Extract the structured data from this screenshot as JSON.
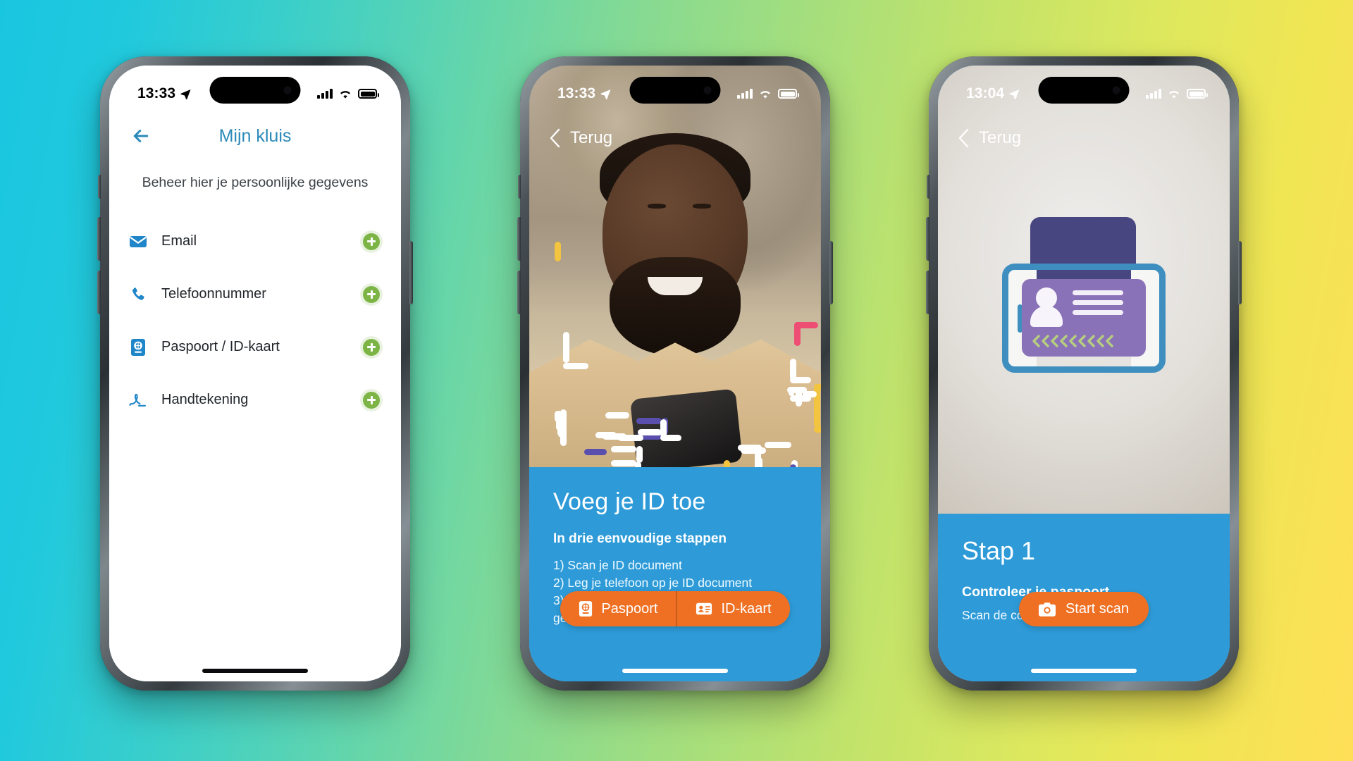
{
  "background": {
    "from": "#19c6e0",
    "mid": "#a3de7e",
    "to": "#ffdf57"
  },
  "theme": {
    "brand_blue": "#2b89b8",
    "panel_blue": "#2e9bd8",
    "orange": "#ef7023",
    "green": "#7cb446",
    "icon_blue": "#1f86c9",
    "purple_doc": "#474681",
    "purple_card": "#8a72b8",
    "chevron_green": "#b6cf7e"
  },
  "phones": [
    {
      "id": "phone-1",
      "status_bar": {
        "time": "13:33",
        "location_icon": "location-arrow-icon",
        "signal_icon": "cellular-bars-icon",
        "wifi_icon": "wifi-icon",
        "battery_icon": "battery-icon"
      },
      "screen": {
        "name": "mijn-kluis",
        "back_icon": "arrow-left-icon",
        "title": "Mijn kluis",
        "subtitle": "Beheer hier je persoonlijke gegevens",
        "rows": [
          {
            "icon": "envelope-icon",
            "label": "Email",
            "action_icon": "plus-circle-icon"
          },
          {
            "icon": "phone-icon",
            "label": "Telefoonnummer",
            "action_icon": "plus-circle-icon"
          },
          {
            "icon": "passport-icon",
            "label": "Paspoort / ID-kaart",
            "action_icon": "plus-circle-icon"
          },
          {
            "icon": "signature-icon",
            "label": "Handtekening",
            "action_icon": "plus-circle-icon"
          }
        ]
      }
    },
    {
      "id": "phone-2",
      "status_bar": {
        "time": "13:33",
        "location_icon": "location-arrow-icon",
        "signal_icon": "cellular-bars-icon",
        "wifi_icon": "wifi-icon",
        "battery_icon": "battery-icon"
      },
      "screen": {
        "name": "voeg-je-id-toe",
        "back_icon": "chevron-left-icon",
        "back_label": "Terug",
        "hero_alt": "man-with-phone-photo",
        "heading": "Voeg je ID toe",
        "subheading": "In drie eenvoudige stappen",
        "steps": [
          "1) Scan je ID document",
          "2) Leg je telefoon op je ID document",
          "3) Volg de aanwijzingen voor de",
          "gezichtsherkenning"
        ],
        "buttons": [
          {
            "icon": "passport-icon",
            "label": "Paspoort"
          },
          {
            "icon": "id-card-icon",
            "label": "ID-kaart"
          }
        ]
      }
    },
    {
      "id": "phone-3",
      "status_bar": {
        "time": "13:04",
        "location_icon": "location-arrow-icon",
        "signal_icon": "cellular-bars-icon",
        "wifi_icon": "wifi-icon",
        "battery_icon": "battery-icon"
      },
      "screen": {
        "name": "stap-1",
        "back_icon": "chevron-left-icon",
        "back_label": "Terug",
        "illustration": "phone-on-id-document-illustration",
        "heading": "Stap 1",
        "subheading": "Controleer je paspoort",
        "description": "Scan de code van jouw paspoort",
        "button": {
          "icon": "camera-icon",
          "label": "Start scan"
        }
      }
    }
  ]
}
